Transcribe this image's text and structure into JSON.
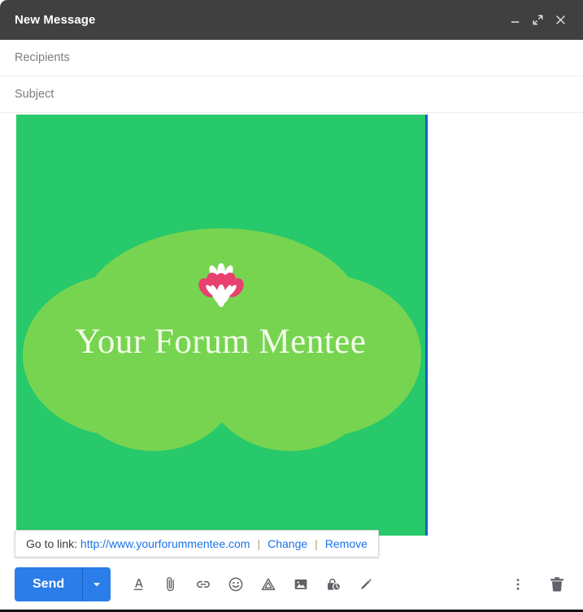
{
  "window": {
    "title": "New Message",
    "controls": [
      {
        "name": "minimize",
        "label": "Minimize"
      },
      {
        "name": "expand",
        "label": "Full screen"
      },
      {
        "name": "close",
        "label": "Save & close"
      }
    ]
  },
  "fields": {
    "recipients": {
      "placeholder": "Recipients",
      "value": ""
    },
    "subject": {
      "placeholder": "Subject",
      "value": ""
    }
  },
  "banner": {
    "title": "Your Forum Mentee",
    "background_color": "#27c96a",
    "blob_color": "#77d451",
    "title_color": "#f2fce9",
    "flower_petal_color": "#e8406f",
    "flower_center_color": "#ffffff",
    "selection_border_color": "#1a5fd0"
  },
  "link_popup": {
    "label": "Go to link:",
    "url": "http://www.yourforummentee.com",
    "separator": "|",
    "change_label": "Change",
    "remove_label": "Remove"
  },
  "toolbar": {
    "send_label": "Send",
    "send_color": "#2b7de9",
    "send_dropdown_icon": "caret-down-icon",
    "icons": [
      {
        "name": "formatting-options-icon",
        "label": "Formatting options"
      },
      {
        "name": "attach-file-icon",
        "label": "Attach files"
      },
      {
        "name": "insert-link-icon",
        "label": "Insert link"
      },
      {
        "name": "insert-emoji-icon",
        "label": "Insert emoji"
      },
      {
        "name": "insert-drive-file-icon",
        "label": "Insert files using Drive"
      },
      {
        "name": "insert-photo-icon",
        "label": "Insert photo"
      },
      {
        "name": "confidential-mode-icon",
        "label": "Toggle confidential mode"
      },
      {
        "name": "insert-signature-icon",
        "label": "Insert signature"
      }
    ],
    "more_options": {
      "name": "more-options-icon",
      "label": "More options"
    },
    "discard": {
      "name": "discard-draft-icon",
      "label": "Discard draft"
    }
  }
}
